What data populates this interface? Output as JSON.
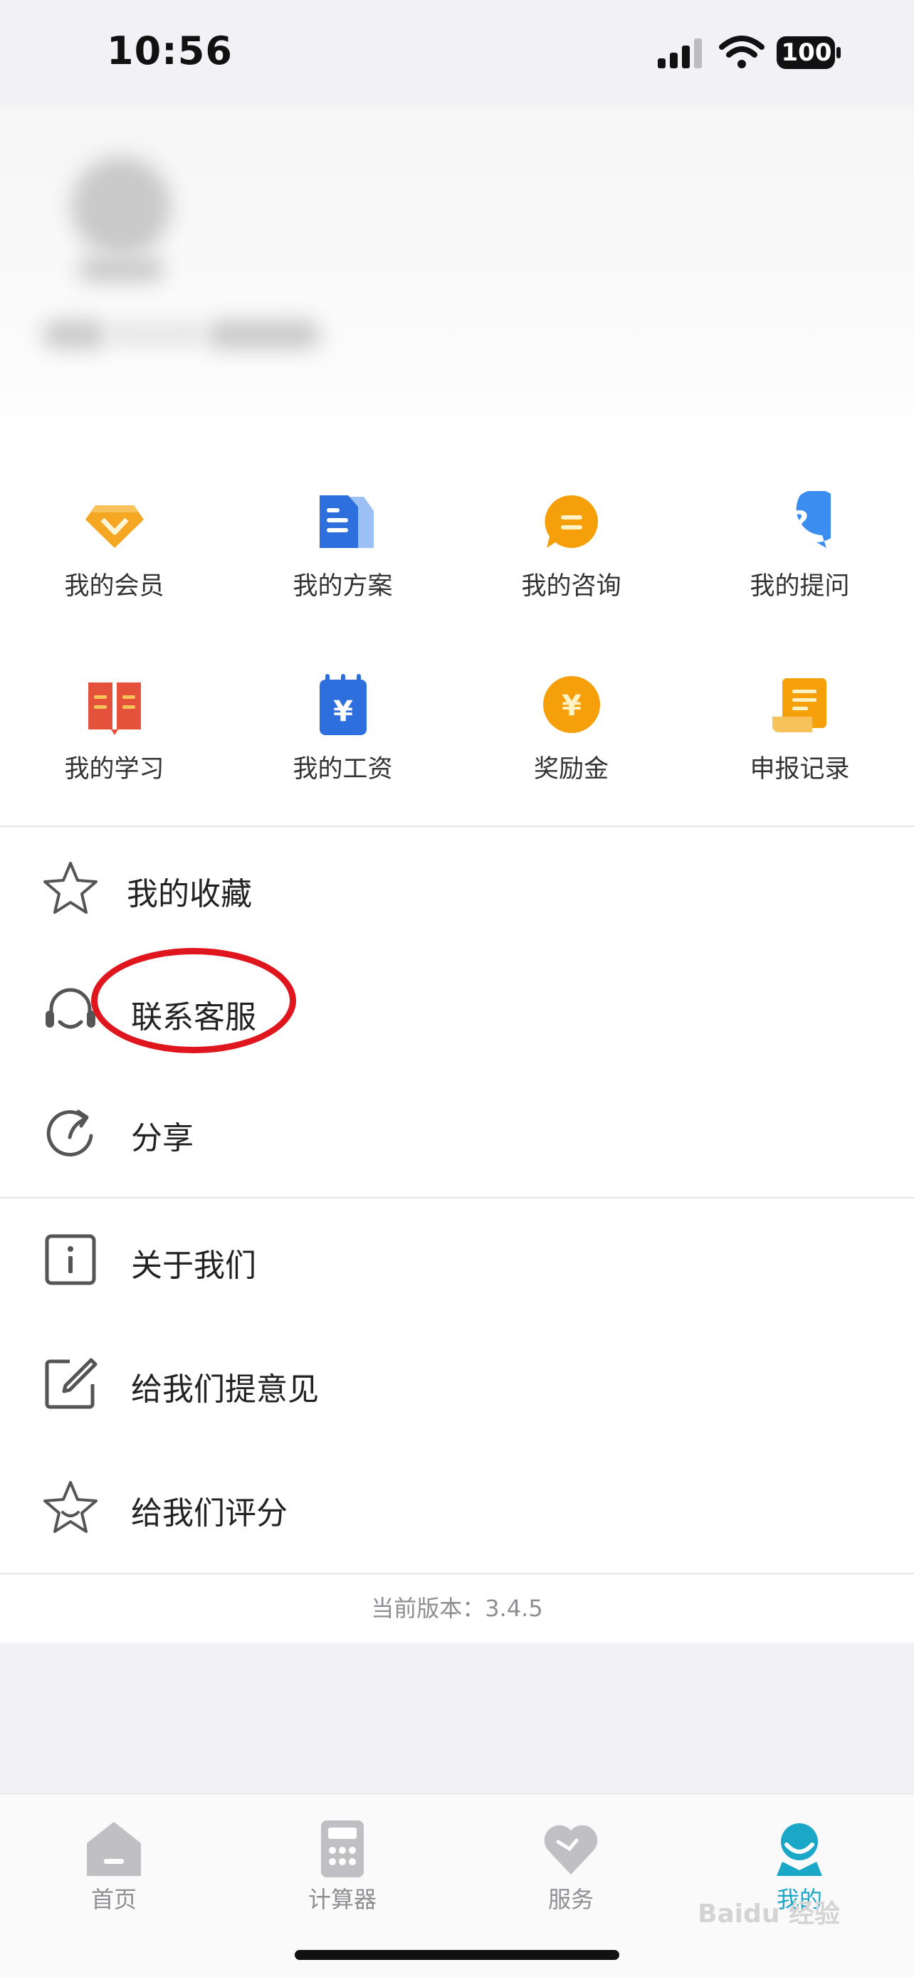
{
  "status_bar": {
    "time": "10:56",
    "battery": "100"
  },
  "grid": [
    {
      "label": "我的会员",
      "icon": "diamond-icon",
      "color": "#f5a623"
    },
    {
      "label": "我的方案",
      "icon": "document-icon",
      "color": "#2e6fde"
    },
    {
      "label": "我的咨询",
      "icon": "chat-bubble-icon",
      "color": "#f5a00a"
    },
    {
      "label": "我的提问",
      "icon": "question-bubble-icon",
      "color": "#3b8ef0"
    },
    {
      "label": "我的学习",
      "icon": "book-icon",
      "color": "#e4523b"
    },
    {
      "label": "我的工资",
      "icon": "salary-slip-icon",
      "color": "#2e6fde"
    },
    {
      "label": "奖励金",
      "icon": "coin-icon",
      "color": "#f5a00a"
    },
    {
      "label": "申报记录",
      "icon": "scroll-icon",
      "color": "#f5a00a"
    }
  ],
  "menu": {
    "favorites": "我的收藏",
    "contact": "联系客服",
    "share": "分享",
    "about": "关于我们",
    "feedback": "给我们提意见",
    "rate": "给我们评分"
  },
  "version": "当前版本：3.4.5",
  "tabs": [
    {
      "label": "首页",
      "icon": "home-icon"
    },
    {
      "label": "计算器",
      "icon": "calculator-icon"
    },
    {
      "label": "服务",
      "icon": "heart-icon"
    },
    {
      "label": "我的",
      "icon": "profile-icon",
      "active": true
    }
  ],
  "watermark": "Baidu 经验"
}
